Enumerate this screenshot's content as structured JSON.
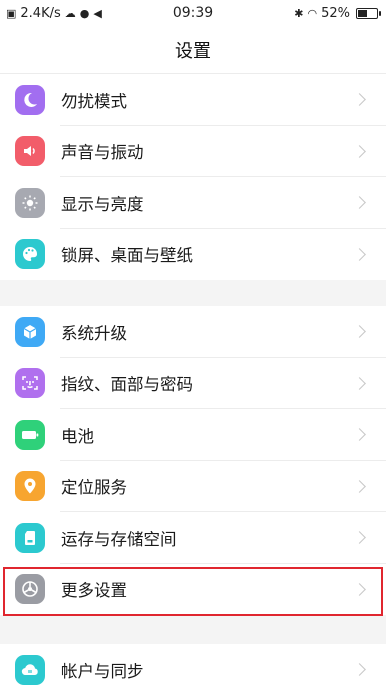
{
  "status": {
    "speed": "2.4K/s",
    "time": "09:39",
    "battery_pct": "52%",
    "battery_level": 0.52
  },
  "title": "设置",
  "groups": [
    {
      "items": [
        {
          "label": "勿扰模式",
          "icon": "moon-icon",
          "color": "#a26ef0"
        },
        {
          "label": "声音与振动",
          "icon": "speaker-icon",
          "color": "#f25d6a"
        },
        {
          "label": "显示与亮度",
          "icon": "sun-icon",
          "color": "#a7a9b1"
        },
        {
          "label": "锁屏、桌面与壁纸",
          "icon": "palette-icon",
          "color": "#2cc9cf"
        }
      ]
    },
    {
      "items": [
        {
          "label": "系统升级",
          "icon": "cube-icon",
          "color": "#3fa9f5"
        },
        {
          "label": "指纹、面部与密码",
          "icon": "face-id-icon",
          "color": "#b070ee"
        },
        {
          "label": "电池",
          "icon": "battery-icon",
          "color": "#2fd17a"
        },
        {
          "label": "定位服务",
          "icon": "location-pin-icon",
          "color": "#f7a530"
        },
        {
          "label": "运存与存储空间",
          "icon": "sd-card-icon",
          "color": "#2cc9cf"
        },
        {
          "label": "更多设置",
          "icon": "gear-icon",
          "color": "#9a9ca3"
        }
      ]
    },
    {
      "items": [
        {
          "label": "帐户与同步",
          "icon": "cloud-sync-icon",
          "color": "#2cc9cf"
        }
      ]
    }
  ]
}
